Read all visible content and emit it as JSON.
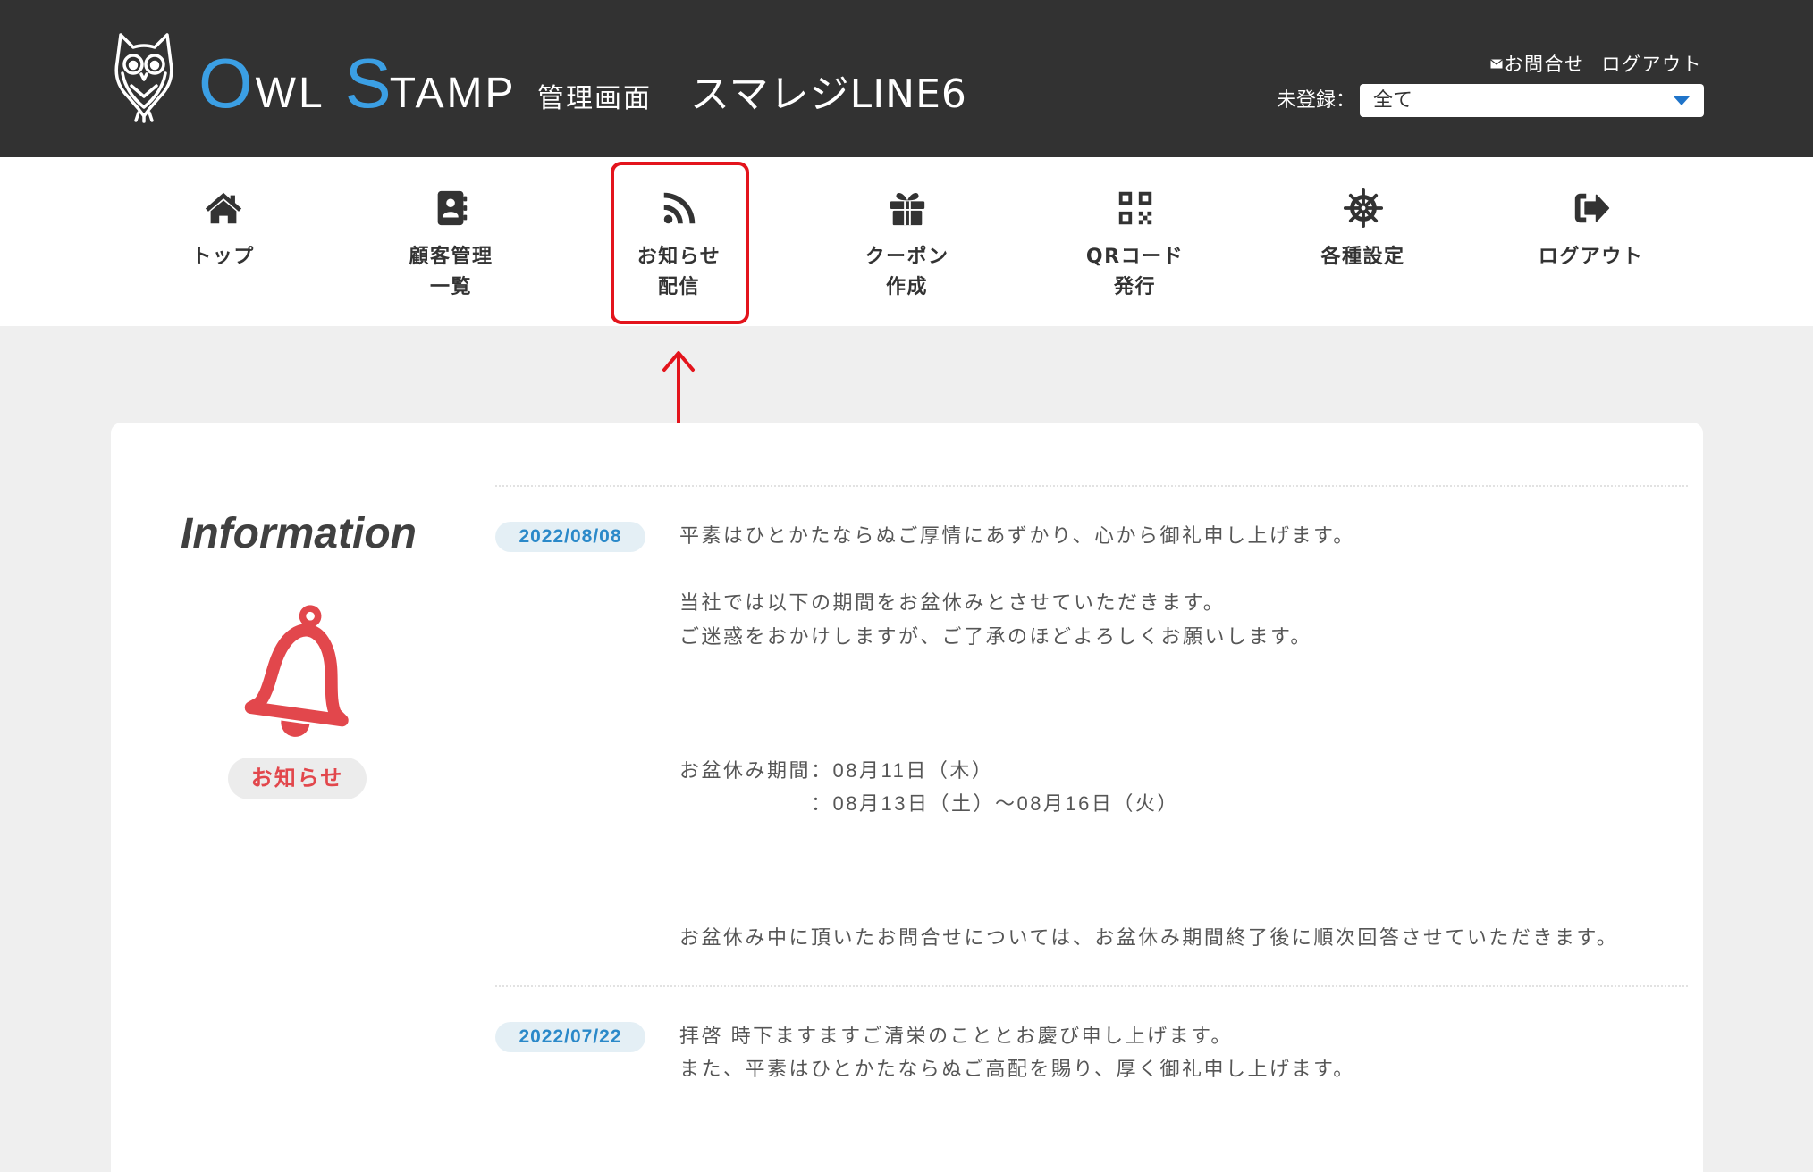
{
  "header": {
    "brand": {
      "o": "O",
      "wl": "WL",
      "s": "S",
      "tamp": "TAMP"
    },
    "subtitle": "管理画面",
    "shop_name": "スマレジLINE6",
    "links": {
      "contact": "お問合せ",
      "logout": "ログアウト"
    },
    "filter": {
      "label": "未登録：",
      "value": "全て"
    }
  },
  "nav": [
    {
      "icon": "home-icon",
      "label": [
        "トップ"
      ]
    },
    {
      "icon": "address-book-icon",
      "label": [
        "顧客管理",
        "一覧"
      ]
    },
    {
      "icon": "rss-icon",
      "label": [
        "お知らせ",
        "配信"
      ],
      "highlighted": true
    },
    {
      "icon": "gift-icon",
      "label": [
        "クーポン",
        "作成"
      ]
    },
    {
      "icon": "qrcode-icon",
      "label": [
        "QRコード",
        "発行"
      ]
    },
    {
      "icon": "ship-wheel-icon",
      "label": [
        "各種設定"
      ]
    },
    {
      "icon": "sign-out-icon",
      "label": [
        "ログアウト"
      ]
    }
  ],
  "information": {
    "title": "Information",
    "icon": "bell-icon",
    "badge": "お知らせ"
  },
  "posts": [
    {
      "date": "2022/08/08",
      "greeting": "平素はひとかたならぬご厚情にあずかり、心から御礼申し上げます。",
      "notice": [
        "当社では以下の期間をお盆休みとさせていただきます。",
        "ご迷惑をおかけしますが、ご了承のほどよろしくお願いします。"
      ],
      "holiday": {
        "label": "お盆休み期間",
        "dates": [
          "：08月11日（木）",
          "：08月13日（土）〜08月16日（火）"
        ]
      },
      "closing": "お盆休み中に頂いたお問合せについては、お盆休み期間終了後に順次回答させていただきます。"
    },
    {
      "date": "2022/07/22",
      "lines": [
        "拝啓 時下ますますご清栄のこととお慶び申し上げます。",
        "また、平素はひとかたならぬご高配を賜り、厚く御礼申し上げます。"
      ]
    }
  ],
  "colors": {
    "header_bg": "#323232",
    "brand_blue": "#3b9fe4",
    "accent_red": "#e2474c",
    "annotation_red": "#e3141c",
    "date_text": "#2b89c9",
    "date_bg": "#e4eff5",
    "page_bg": "#efefef",
    "body_text": "#565656",
    "ink": "#333333"
  }
}
